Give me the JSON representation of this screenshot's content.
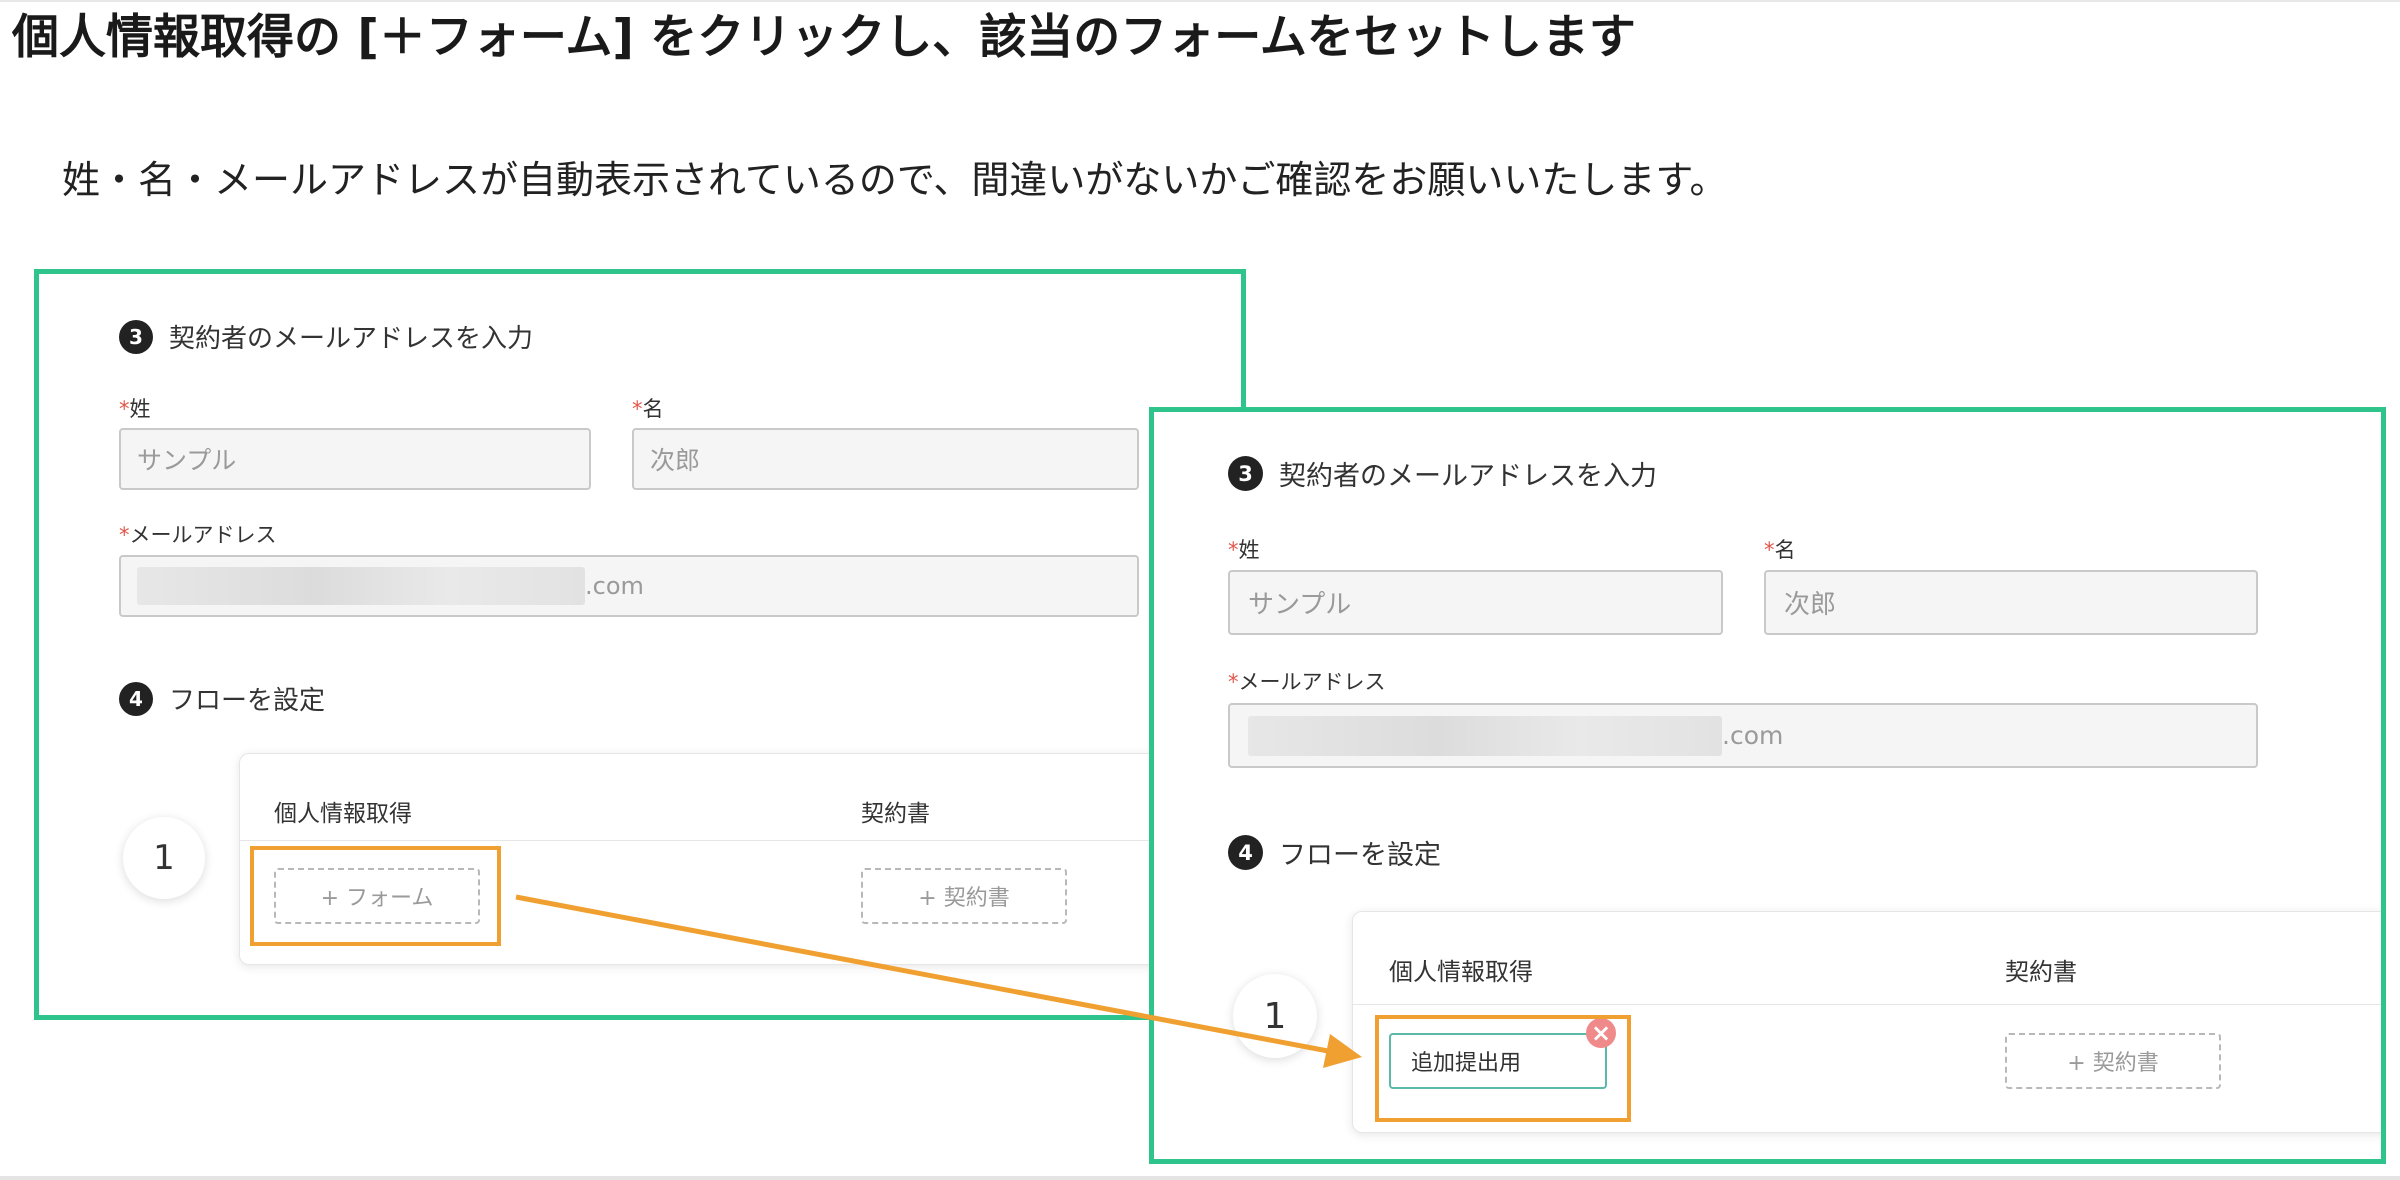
{
  "heading": "個人情報取得の [＋フォーム] をクリックし、該当のフォームをセットします",
  "instruction": "姓・名・メールアドレスが自動表示されているので、間違いがないかご確認をお願いいたします。",
  "colors": {
    "frame": "#2ec48b",
    "highlight": "#f0a030",
    "required": "#e2574c",
    "set_form_border": "#5bb9a7",
    "remove_icon": "#f08a8a"
  },
  "before": {
    "step3": {
      "number": "3",
      "label": "契約者のメールアドレスを入力"
    },
    "fields": {
      "last_name": {
        "required_mark": "*",
        "label": "姓",
        "value": "サンプル"
      },
      "first_name": {
        "required_mark": "*",
        "label": "名",
        "value": "次郎"
      },
      "email": {
        "required_mark": "*",
        "label": "メールアドレス",
        "value_suffix": ".com"
      }
    },
    "step4": {
      "number": "4",
      "label": "フローを設定"
    },
    "flow": {
      "row_number": "1",
      "col_personal": "個人情報取得",
      "col_contract": "契約書",
      "add_form": "+ フォーム",
      "add_contract": "+ 契約書"
    }
  },
  "after": {
    "step3": {
      "number": "3",
      "label": "契約者のメールアドレスを入力"
    },
    "fields": {
      "last_name": {
        "required_mark": "*",
        "label": "姓",
        "value": "サンプル"
      },
      "first_name": {
        "required_mark": "*",
        "label": "名",
        "value": "次郎"
      },
      "email": {
        "required_mark": "*",
        "label": "メールアドレス",
        "value_suffix": ".com"
      }
    },
    "step4": {
      "number": "4",
      "label": "フローを設定"
    },
    "flow": {
      "row_number": "1",
      "col_personal": "個人情報取得",
      "col_contract": "契約書",
      "set_form": "追加提出用",
      "remove_icon": "×",
      "add_contract": "+ 契約書"
    }
  }
}
